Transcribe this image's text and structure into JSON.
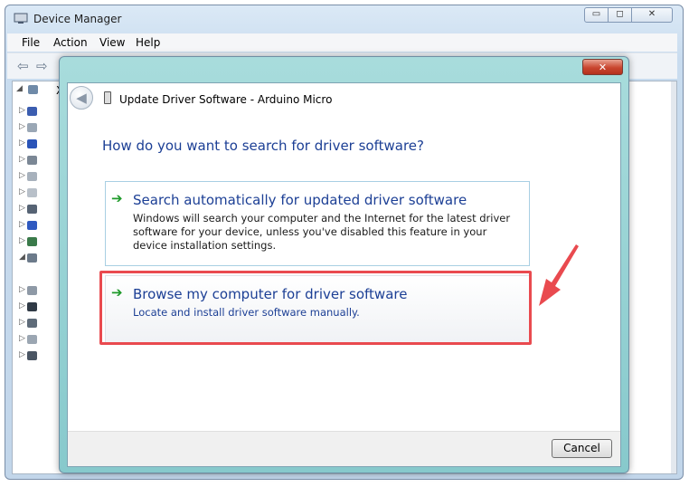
{
  "device_manager": {
    "title": "Device Manager",
    "caption_buttons": {
      "minimize": "▭",
      "maximize": "◻",
      "close": "✕"
    },
    "menu": [
      "File",
      "Action",
      "View",
      "Help"
    ],
    "tree_root_label": "X"
  },
  "wizard": {
    "title": "Update Driver Software - Arduino Micro",
    "close_glyph": "✕",
    "back_glyph": "◀",
    "question": "How do you want to search for driver software?",
    "options": [
      {
        "title": "Search automatically for updated driver software",
        "description": "Windows will search your computer and the Internet for the latest driver software for your device, unless you've disabled this feature in your device installation settings."
      },
      {
        "title": "Browse my computer for driver software",
        "description": "Locate and install driver software manually."
      }
    ],
    "option_arrow_glyph": "➔",
    "cancel_label": "Cancel"
  },
  "annotation": {
    "highlight_color": "#e94a4f"
  }
}
